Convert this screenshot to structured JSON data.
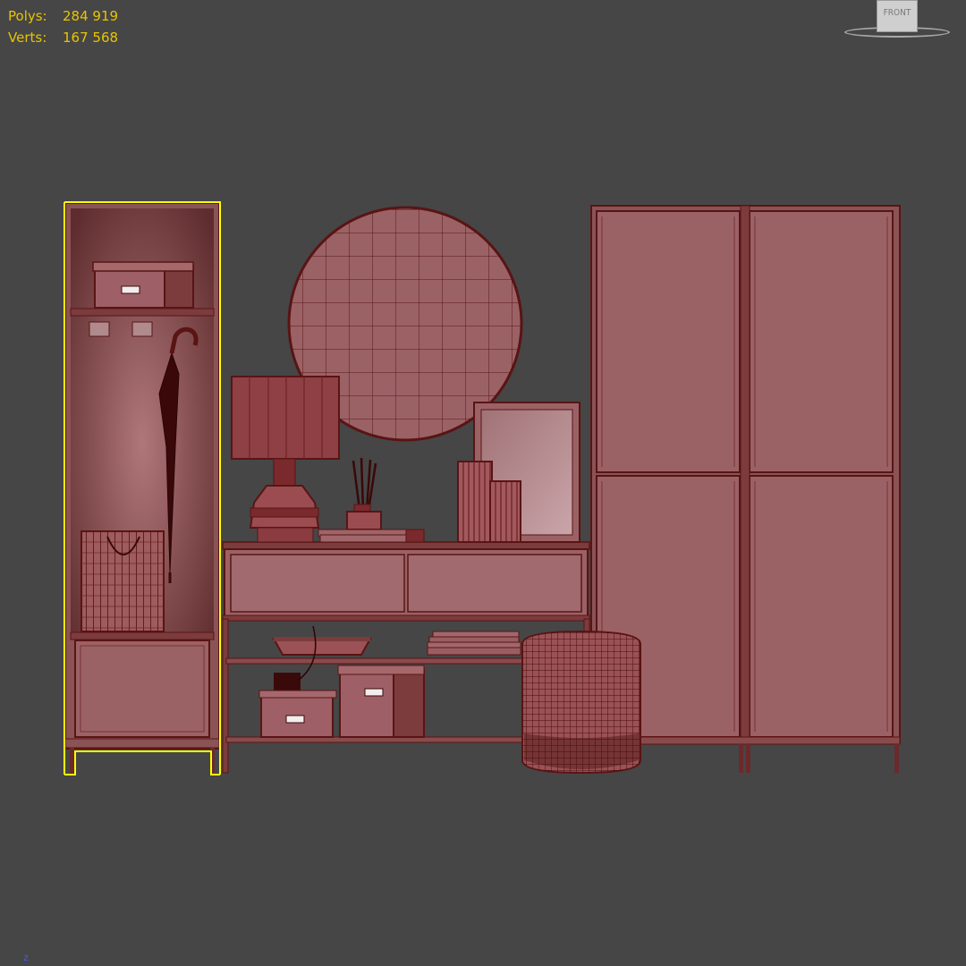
{
  "viewport": {
    "background": "#464646",
    "view_label": "FRONT",
    "axis_label": "z",
    "selection_color": "#ffff00",
    "material_color": "#9b6266",
    "wire_color": "#5a1414"
  },
  "statistics": {
    "polys_label": "Polys:",
    "polys_value": "284 919",
    "verts_label": "Verts:",
    "verts_value": "167 568",
    "text_color": "#e8c400"
  },
  "scene_objects": [
    {
      "name": "hallway-cabinet",
      "selected": true
    },
    {
      "name": "round-mirror"
    },
    {
      "name": "table-lamp"
    },
    {
      "name": "reed-diffuser"
    },
    {
      "name": "vases"
    },
    {
      "name": "picture-frame"
    },
    {
      "name": "console-table"
    },
    {
      "name": "wardrobe"
    },
    {
      "name": "pouf"
    },
    {
      "name": "storage-boxes"
    },
    {
      "name": "umbrella"
    },
    {
      "name": "shopping-bag"
    },
    {
      "name": "decor-bowl"
    },
    {
      "name": "books"
    }
  ]
}
